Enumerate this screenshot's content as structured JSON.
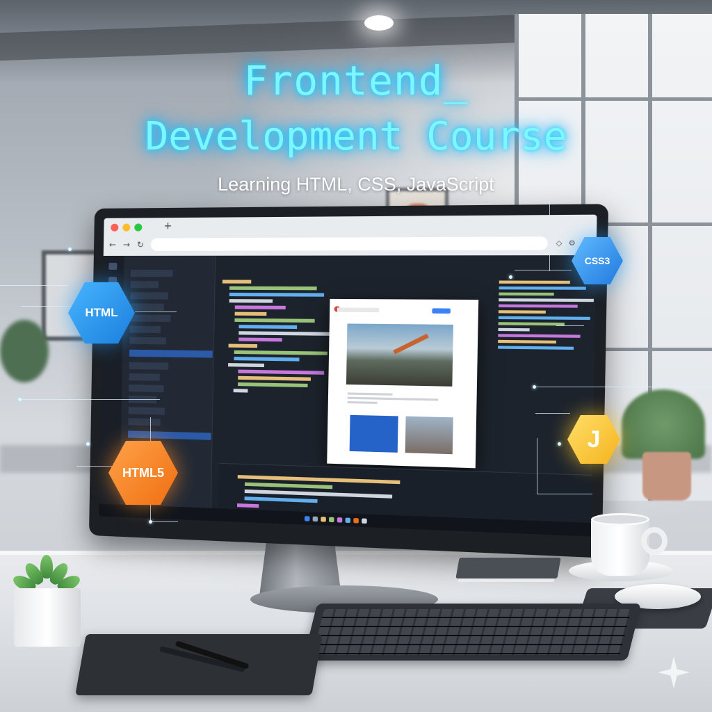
{
  "title": {
    "line1": "Frontend_",
    "line2": "Development Course",
    "subtitle": "Learning HTML, CSS, JavaScript"
  },
  "badges": {
    "html": "HTML",
    "css3": "CSS3",
    "html5": "HTML5",
    "js": "J"
  },
  "colors": {
    "title_glow": "#19d8ff",
    "html_badge": "#1a7ddc",
    "css_badge": "#1f78de",
    "html5_badge": "#f06d10",
    "js_badge": "#f5b21c"
  },
  "icons": [
    "sparkle-icon"
  ]
}
